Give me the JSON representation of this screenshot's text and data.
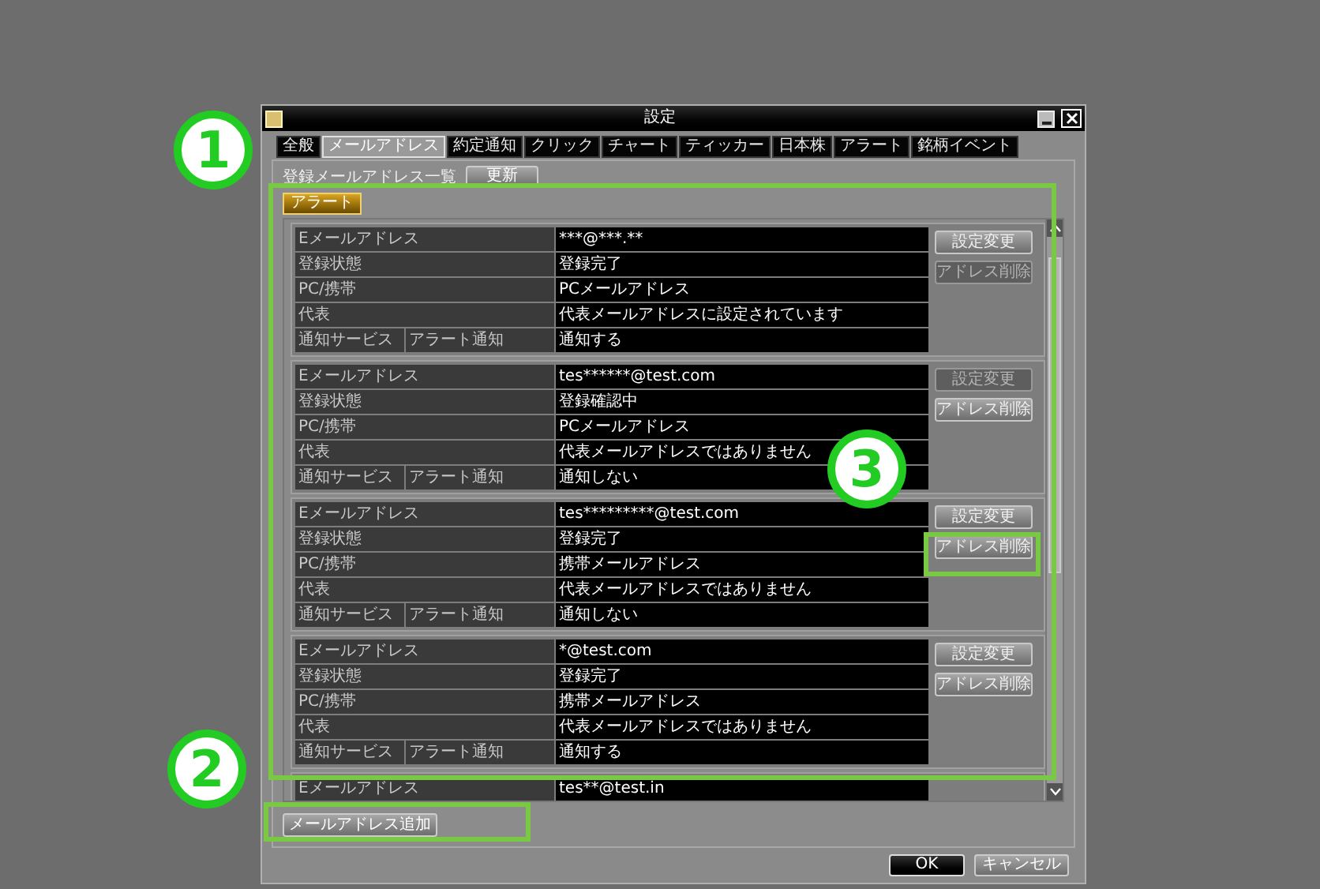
{
  "window": {
    "title": "設定"
  },
  "tabs": [
    {
      "label": "全般",
      "selected": false
    },
    {
      "label": "メールアドレス",
      "selected": true
    },
    {
      "label": "約定通知",
      "selected": false
    },
    {
      "label": "クリック",
      "selected": false
    },
    {
      "label": "チャート",
      "selected": false
    },
    {
      "label": "ティッカー",
      "selected": false
    },
    {
      "label": "日本株",
      "selected": false
    },
    {
      "label": "アラート",
      "selected": false
    },
    {
      "label": "銘柄イベント",
      "selected": false
    }
  ],
  "list_header": {
    "label": "登録メールアドレス一覧",
    "refresh_button": "更新"
  },
  "group_tag": "アラート",
  "entries": [
    {
      "rows": [
        {
          "label": "Eメールアドレス",
          "value": "***@***.**"
        },
        {
          "label": "登録状態",
          "value": "登録完了"
        },
        {
          "label": "PC/携帯",
          "value": "PCメールアドレス"
        },
        {
          "label": "代表",
          "value": "代表メールアドレスに設定されています"
        },
        {
          "label": "通知サービス",
          "sublabel": "アラート通知",
          "value": "通知する"
        }
      ],
      "buttons": [
        {
          "label": "設定変更",
          "disabled": false
        },
        {
          "label": "アドレス削除",
          "disabled": true
        }
      ]
    },
    {
      "rows": [
        {
          "label": "Eメールアドレス",
          "value": "tes******@test.com"
        },
        {
          "label": "登録状態",
          "value": "登録確認中"
        },
        {
          "label": "PC/携帯",
          "value": "PCメールアドレス"
        },
        {
          "label": "代表",
          "value": "代表メールアドレスではありません"
        },
        {
          "label": "通知サービス",
          "sublabel": "アラート通知",
          "value": "通知しない"
        }
      ],
      "buttons": [
        {
          "label": "設定変更",
          "disabled": true
        },
        {
          "label": "アドレス削除",
          "disabled": false
        }
      ]
    },
    {
      "rows": [
        {
          "label": "Eメールアドレス",
          "value": "tes*********@test.com"
        },
        {
          "label": "登録状態",
          "value": "登録完了"
        },
        {
          "label": "PC/携帯",
          "value": "携帯メールアドレス"
        },
        {
          "label": "代表",
          "value": "代表メールアドレスではありません"
        },
        {
          "label": "通知サービス",
          "sublabel": "アラート通知",
          "value": "通知しない"
        }
      ],
      "buttons": [
        {
          "label": "設定変更",
          "disabled": false
        },
        {
          "label": "アドレス削除",
          "disabled": false
        }
      ]
    },
    {
      "rows": [
        {
          "label": "Eメールアドレス",
          "value": "*@test.com"
        },
        {
          "label": "登録状態",
          "value": "登録完了"
        },
        {
          "label": "PC/携帯",
          "value": "携帯メールアドレス"
        },
        {
          "label": "代表",
          "value": "代表メールアドレスではありません"
        },
        {
          "label": "通知サービス",
          "sublabel": "アラート通知",
          "value": "通知する"
        }
      ],
      "buttons": [
        {
          "label": "設定変更",
          "disabled": false
        },
        {
          "label": "アドレス削除",
          "disabled": false
        }
      ]
    },
    {
      "rows": [
        {
          "label": "Eメールアドレス",
          "value": "tes**@test.in"
        }
      ]
    }
  ],
  "add_button": "メールアドレス追加",
  "footer_buttons": [
    {
      "label": "OK",
      "kind": "primary"
    },
    {
      "label": "キャンセル",
      "kind": "secondary"
    }
  ],
  "callouts": [
    {
      "number": "1"
    },
    {
      "number": "2"
    },
    {
      "number": "3"
    }
  ]
}
